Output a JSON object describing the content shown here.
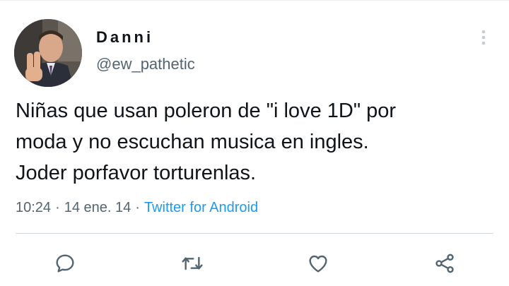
{
  "tweet": {
    "display_name": "Danni",
    "handle": "@ew_pathetic",
    "text": "Niñas que usan poleron de \"i love 1D\" por\nmoda y no escuchan musica en ingles.\nJoder porfavor torturenlas.",
    "time": "10:24",
    "date": "14 ene. 14",
    "source": "Twitter for Android"
  },
  "icons": {
    "more": "more-vertical-icon",
    "reply": "reply-icon",
    "retweet": "retweet-icon",
    "like": "like-icon",
    "share": "share-icon"
  },
  "colors": {
    "text": "#0f1419",
    "secondary": "#536471",
    "link": "#1d9bf0",
    "divider": "#cfd9de"
  }
}
